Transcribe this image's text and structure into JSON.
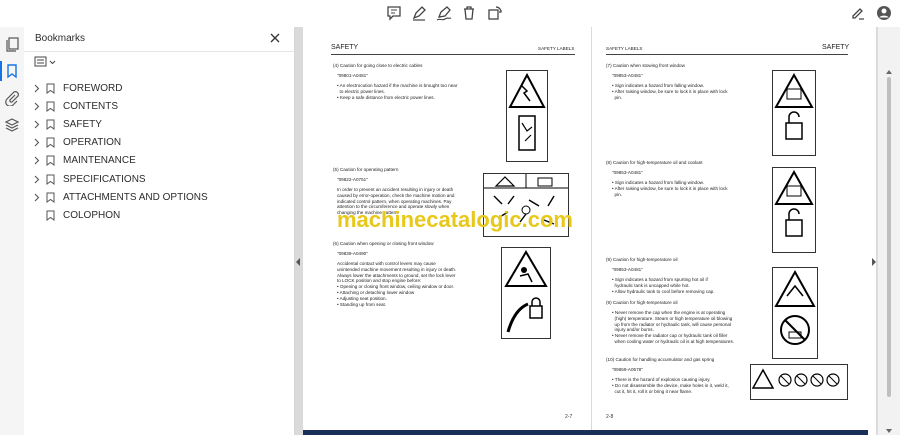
{
  "toolbar": {
    "tools": [
      "comment-icon",
      "highlight-pen-icon",
      "draw-icon",
      "delete-icon",
      "rotate-icon"
    ],
    "right_tools": [
      "sign-icon",
      "account-icon"
    ]
  },
  "bookmarks_panel": {
    "title": "Bookmarks",
    "items": [
      {
        "label": "FOREWORD",
        "expandable": true
      },
      {
        "label": "CONTENTS",
        "expandable": true
      },
      {
        "label": "SAFETY",
        "expandable": true
      },
      {
        "label": "OPERATION",
        "expandable": true
      },
      {
        "label": "MAINTENANCE",
        "expandable": true
      },
      {
        "label": "SPECIFICATIONS",
        "expandable": true
      },
      {
        "label": "ATTACHMENTS AND OPTIONS",
        "expandable": true
      },
      {
        "label": "COLOPHON",
        "expandable": false
      }
    ]
  },
  "document": {
    "left_page": {
      "header_left": "SAFETY",
      "header_right": "SAFETY LABELS",
      "page_number": "2-7",
      "sections": {
        "s4_title": "(4) Caution for going close to electric cables",
        "s4_code": "\"09801-A0481\"",
        "s4_lines": "• An electrocution hazard if the machine is brought too near\n  to electric power lines.\n• Keep a safe distance from electric power lines.",
        "s5_title": "(5) Caution for operating pattern",
        "s5_code": "\"09822-A0751\"",
        "s5_lines": "In order to prevent an accident resulting in injury or death\ncaused by error-operation, check the machine motion and\nindicated control pattern, when operating machines. Pay\nattention to the circumference and operate slowly when\nchanging the machine pattern.",
        "s6_title": "(6) Caution when opening or closing front window",
        "s6_code": "\"09839-A0490\"",
        "s6_lines": "Accidental contact with control levers may cause\nunintended machine movement resulting in injury or death.\nAlways lower the attachments to ground, set the lock lever\nto LOCK position and stop engine before:\n• Opening or closing front window, ceiling window or door.\n• Attaching or detaching lower window\n• Adjusting seat position.\n• Standing up from seat."
      }
    },
    "right_page": {
      "header_left": "SAFETY LABELS",
      "header_right": "SAFETY",
      "page_number": "2-8",
      "sections": {
        "s7_title": "(7) Caution when stowing front window",
        "s7_code": "\"09853-A0481\"",
        "s7_lines": "• Sign indicates a hazard from falling window.\n• After raising window, be sure to lock it in place with lock\n  pin.",
        "s8_title": "(8) Caution for high-temperature oil and coolant",
        "s8_code": "\"09853-A0481\"",
        "s8_lines": "• Sign indicates a hazard from falling window.\n• After raising window, be sure to lock it in place with lock\n  pin.",
        "s9a_title": "(9) Caution for high-temperature oil",
        "s9a_code": "\"09853-A0481\"",
        "s9a_lines": "• Sign indicates a hazard from spurting hot oil if\n  hydraulic tank is uncapped while hot.\n• Allow hydraulic tank to cool before removing cap.",
        "s9b_title": "(9) Caution for high-temperature oil",
        "s9b_lines": "• Never remove the cap when the engine is at operating\n  (high) temperature. Steam or high temperature oil blowing\n  up from the radiator or hydraulic tank, will cause personal\n  injury and/or burns.\n• Never remove the radiator cap or hydraulic tank oil filler\n  when cooling water or hydraulic oil is at high temperatures.",
        "s10_title": "(10) Caution for handling accumulator and gas spring",
        "s10_code": "\"09659-A0578\"",
        "s10_lines": "• There is the hazard of explosion causing injury.\n• Do not disassemble the device, make holes in it, weld it,\n  cut it, hit it, roll it or bring it near flame."
      }
    },
    "watermark": "machinecatalogic.com"
  },
  "colors": {
    "accent": "#1473e6",
    "watermark": "#e8c81a",
    "viewer_bg": "#dadada"
  }
}
